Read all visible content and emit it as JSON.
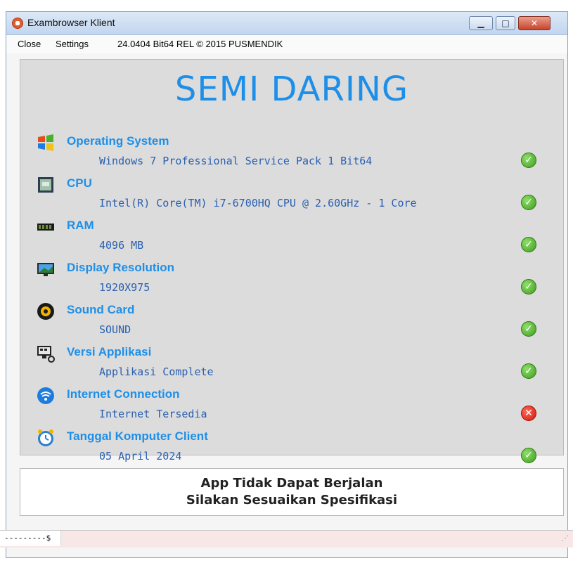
{
  "window": {
    "title": "Exambrowser Klient"
  },
  "menu": {
    "close": "Close",
    "settings": "Settings",
    "version": "24.0404 Bit64 REL © 2015 PUSMENDIK"
  },
  "main": {
    "title": "SEMI DARING"
  },
  "checks": [
    {
      "label": "Operating System",
      "value": "Windows 7 Professional Service Pack 1 Bit64",
      "status": "ok"
    },
    {
      "label": "CPU",
      "value": "Intel(R) Core(TM) i7-6700HQ CPU @ 2.60GHz - 1 Core",
      "status": "ok"
    },
    {
      "label": "RAM",
      "value": "4096 MB",
      "status": "ok"
    },
    {
      "label": "Display Resolution",
      "value": "1920X975",
      "status": "ok"
    },
    {
      "label": "Sound Card",
      "value": "SOUND",
      "status": "ok"
    },
    {
      "label": "Versi Applikasi",
      "value": "Applikasi Complete",
      "status": "ok"
    },
    {
      "label": "Internet Connection",
      "value": "Internet Tersedia",
      "status": "fail"
    },
    {
      "label": "Tanggal Komputer Client",
      "value": "05 April 2024",
      "status": "ok"
    }
  ],
  "message": {
    "line1": "App Tidak Dapat Berjalan",
    "line2": "Silakan Sesuaikan Spesifikasi"
  },
  "status": {
    "text": "---------$"
  },
  "colors": {
    "accent": "#1e8fe8",
    "value": "#2a5fb0",
    "ok": "#3f9b1f",
    "fail": "#d2160a"
  },
  "icons": [
    "windows-logo-icon",
    "cpu-icon",
    "ram-icon",
    "monitor-icon",
    "sound-icon",
    "app-version-icon",
    "internet-icon",
    "clock-icon"
  ]
}
